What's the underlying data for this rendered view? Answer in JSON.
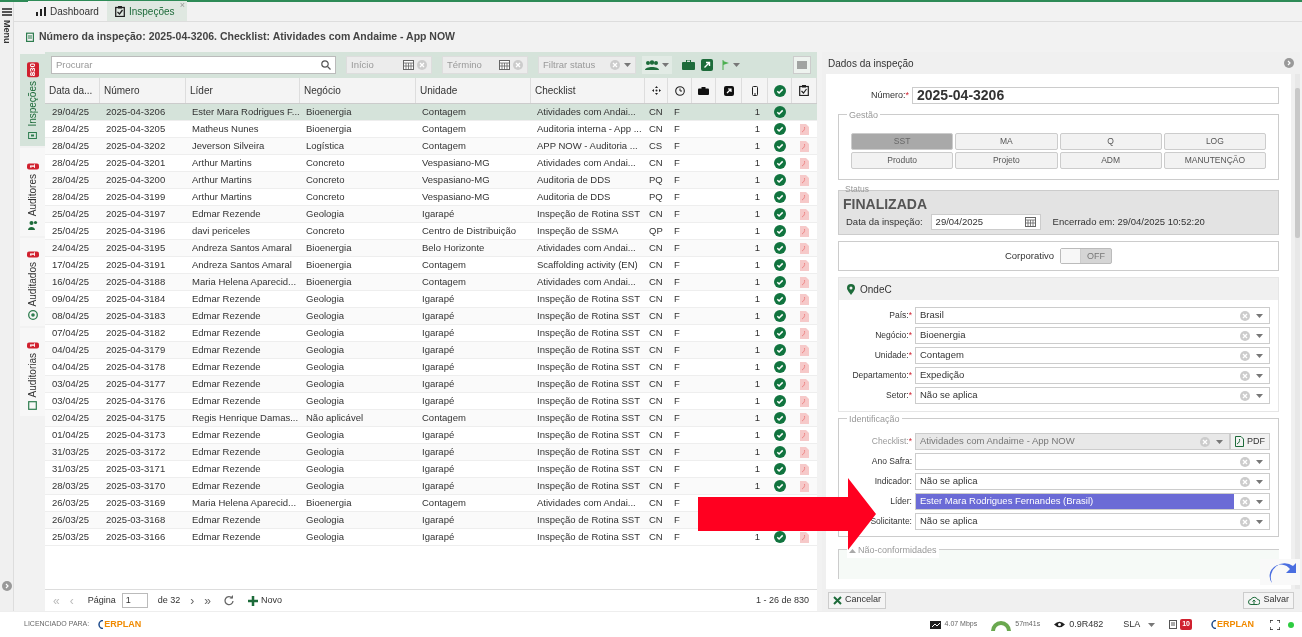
{
  "menu": {
    "label": "Menu"
  },
  "tabs": [
    {
      "label": "Dashboard",
      "selected": false
    },
    {
      "label": "Inspeções",
      "selected": true,
      "close": "×"
    }
  ],
  "title": "Número da inspeção: 2025-04-3206. Checklist: Atividades com Andaime - App NOW",
  "side_tabs": [
    {
      "label": "Inspeções",
      "badge": "830",
      "selected": true
    },
    {
      "label": "Auditores",
      "badge": "1",
      "selected": false
    },
    {
      "label": "Auditados",
      "badge": "1",
      "selected": false
    },
    {
      "label": "Auditorias",
      "badge": "1",
      "selected": false
    }
  ],
  "toolbar": {
    "search": {
      "placeholder": "Procurar"
    },
    "start": {
      "placeholder": "Início"
    },
    "end": {
      "placeholder": "Término"
    },
    "status": {
      "placeholder": "Filtrar status"
    }
  },
  "table": {
    "columns": [
      "Data da...",
      "Número",
      "Líder",
      "Negócio",
      "Unidade",
      "Checklist"
    ],
    "rows": [
      {
        "date": "29/04/25",
        "number": "2025-04-3206",
        "leader": "Ester Mara Rodrigues F...",
        "business": "Bioenergia",
        "unit": "Contagem",
        "checklist": "Atividades com Andai...",
        "code": "CN",
        "status": "F",
        "count": "1",
        "done": true,
        "pdf": false,
        "selected": true
      },
      {
        "date": "28/04/25",
        "number": "2025-04-3205",
        "leader": "Matheus Nunes",
        "business": "Bioenergia",
        "unit": "Contagem",
        "checklist": "Auditoria interna - App ...",
        "code": "CN",
        "status": "F",
        "count": "1",
        "done": true,
        "pdf": true,
        "selected": false
      },
      {
        "date": "28/04/25",
        "number": "2025-04-3202",
        "leader": "Jeverson Silveira",
        "business": "Logística",
        "unit": "Contagem",
        "checklist": "APP NOW - Auditoria ...",
        "code": "CS",
        "status": "F",
        "count": "1",
        "done": true,
        "pdf": true,
        "selected": false
      },
      {
        "date": "28/04/25",
        "number": "2025-04-3201",
        "leader": "Arthur Martins",
        "business": "Concreto",
        "unit": "Vespasiano-MG",
        "checklist": "Atividades com Andai...",
        "code": "CN",
        "status": "F",
        "count": "1",
        "done": true,
        "pdf": true,
        "selected": false
      },
      {
        "date": "28/04/25",
        "number": "2025-04-3200",
        "leader": "Arthur Martins",
        "business": "Concreto",
        "unit": "Vespasiano-MG",
        "checklist": "Auditoria de DDS",
        "code": "PQ",
        "status": "F",
        "count": "1",
        "done": true,
        "pdf": true,
        "selected": false
      },
      {
        "date": "28/04/25",
        "number": "2025-04-3199",
        "leader": "Arthur Martins",
        "business": "Concreto",
        "unit": "Vespasiano-MG",
        "checklist": "Auditoria de DDS",
        "code": "PQ",
        "status": "F",
        "count": "1",
        "done": true,
        "pdf": true,
        "selected": false
      },
      {
        "date": "25/04/25",
        "number": "2025-04-3197",
        "leader": "Edmar Rezende",
        "business": "Geologia",
        "unit": "Igarapé",
        "checklist": "Inspeção de Rotina SST",
        "code": "CN",
        "status": "F",
        "count": "1",
        "done": true,
        "pdf": true,
        "selected": false
      },
      {
        "date": "25/04/25",
        "number": "2025-04-3196",
        "leader": "davi periceles",
        "business": "Concreto",
        "unit": "Centro de Distribuição",
        "checklist": "Inspeção de SSMA",
        "code": "QP",
        "status": "F",
        "count": "1",
        "done": true,
        "pdf": true,
        "selected": false
      },
      {
        "date": "24/04/25",
        "number": "2025-04-3195",
        "leader": "Andreza Santos Amaral",
        "business": "Bioenergia",
        "unit": "Belo Horizonte",
        "checklist": "Atividades com Andai...",
        "code": "CN",
        "status": "F",
        "count": "1",
        "done": true,
        "pdf": true,
        "selected": false
      },
      {
        "date": "17/04/25",
        "number": "2025-04-3191",
        "leader": "Andreza Santos Amaral",
        "business": "Bioenergia",
        "unit": "Contagem",
        "checklist": "Scaffolding activity (EN)",
        "code": "CN",
        "status": "F",
        "count": "1",
        "done": true,
        "pdf": true,
        "selected": false
      },
      {
        "date": "16/04/25",
        "number": "2025-04-3188",
        "leader": "Maria Helena Aparecid...",
        "business": "Bioenergia",
        "unit": "Contagem",
        "checklist": "Atividades com Andai...",
        "code": "CN",
        "status": "F",
        "count": "1",
        "done": true,
        "pdf": true,
        "selected": false
      },
      {
        "date": "09/04/25",
        "number": "2025-04-3184",
        "leader": "Edmar Rezende",
        "business": "Geologia",
        "unit": "Igarapé",
        "checklist": "Inspeção de Rotina SST",
        "code": "CN",
        "status": "F",
        "count": "1",
        "done": true,
        "pdf": true,
        "selected": false
      },
      {
        "date": "08/04/25",
        "number": "2025-04-3183",
        "leader": "Edmar Rezende",
        "business": "Geologia",
        "unit": "Igarapé",
        "checklist": "Inspeção de Rotina SST",
        "code": "CN",
        "status": "F",
        "count": "1",
        "done": true,
        "pdf": true,
        "selected": false
      },
      {
        "date": "07/04/25",
        "number": "2025-04-3182",
        "leader": "Edmar Rezende",
        "business": "Geologia",
        "unit": "Igarapé",
        "checklist": "Inspeção de Rotina SST",
        "code": "CN",
        "status": "F",
        "count": "1",
        "done": true,
        "pdf": true,
        "selected": false
      },
      {
        "date": "04/04/25",
        "number": "2025-04-3179",
        "leader": "Edmar Rezende",
        "business": "Geologia",
        "unit": "Igarapé",
        "checklist": "Inspeção de Rotina SST",
        "code": "CN",
        "status": "F",
        "count": "1",
        "done": true,
        "pdf": true,
        "selected": false
      },
      {
        "date": "04/04/25",
        "number": "2025-04-3178",
        "leader": "Edmar Rezende",
        "business": "Geologia",
        "unit": "Igarapé",
        "checklist": "Inspeção de Rotina SST",
        "code": "CN",
        "status": "F",
        "count": "1",
        "done": true,
        "pdf": true,
        "selected": false
      },
      {
        "date": "03/04/25",
        "number": "2025-04-3177",
        "leader": "Edmar Rezende",
        "business": "Geologia",
        "unit": "Igarapé",
        "checklist": "Inspeção de Rotina SST",
        "code": "CN",
        "status": "F",
        "count": "1",
        "done": true,
        "pdf": true,
        "selected": false
      },
      {
        "date": "03/04/25",
        "number": "2025-04-3176",
        "leader": "Edmar Rezende",
        "business": "Geologia",
        "unit": "Igarapé",
        "checklist": "Inspeção de Rotina SST",
        "code": "CN",
        "status": "F",
        "count": "1",
        "done": true,
        "pdf": true,
        "selected": false
      },
      {
        "date": "02/04/25",
        "number": "2025-04-3175",
        "leader": "Regis Henrique Damas...",
        "business": "Não aplicável",
        "unit": "Contagem",
        "checklist": "Inspeção de Rotina SST",
        "code": "CN",
        "status": "F",
        "count": "1",
        "done": true,
        "pdf": true,
        "selected": false
      },
      {
        "date": "01/04/25",
        "number": "2025-04-3173",
        "leader": "Edmar Rezende",
        "business": "Geologia",
        "unit": "Igarapé",
        "checklist": "Inspeção de Rotina SST",
        "code": "CN",
        "status": "F",
        "count": "1",
        "done": true,
        "pdf": true,
        "selected": false
      },
      {
        "date": "31/03/25",
        "number": "2025-03-3172",
        "leader": "Edmar Rezende",
        "business": "Geologia",
        "unit": "Igarapé",
        "checklist": "Inspeção de Rotina SST",
        "code": "CN",
        "status": "F",
        "count": "1",
        "done": true,
        "pdf": true,
        "selected": false
      },
      {
        "date": "31/03/25",
        "number": "2025-03-3171",
        "leader": "Edmar Rezende",
        "business": "Geologia",
        "unit": "Igarapé",
        "checklist": "Inspeção de Rotina SST",
        "code": "CN",
        "status": "F",
        "count": "1",
        "done": true,
        "pdf": true,
        "selected": false
      },
      {
        "date": "28/03/25",
        "number": "2025-03-3170",
        "leader": "Edmar Rezende",
        "business": "Geologia",
        "unit": "Igarapé",
        "checklist": "Inspeção de Rotina SST",
        "code": "CN",
        "status": "F",
        "count": "1",
        "done": true,
        "pdf": true,
        "selected": false
      },
      {
        "date": "26/03/25",
        "number": "2025-03-3169",
        "leader": "Maria Helena Aparecid...",
        "business": "Bioenergia",
        "unit": "Contagem",
        "checklist": "Atividades com Andai...",
        "code": "CN",
        "status": "F",
        "selected": false
      },
      {
        "date": "26/03/25",
        "number": "2025-03-3168",
        "leader": "Edmar Rezende",
        "business": "Geologia",
        "unit": "Igarapé",
        "checklist": "Inspeção de Rotina SST",
        "code": "CN",
        "status": "F",
        "selected": false
      },
      {
        "date": "25/03/25",
        "number": "2025-03-3166",
        "leader": "Edmar Rezende",
        "business": "Geologia",
        "unit": "Igarapé",
        "checklist": "Inspeção de Rotina SST",
        "code": "CN",
        "status": "F",
        "count": "1",
        "done": true,
        "pdf": true,
        "selected": false
      }
    ]
  },
  "pager": {
    "first": "«",
    "previous": "‹",
    "next": "›",
    "last": "»",
    "page_label": "Página",
    "page": "1",
    "of": "de 32",
    "new": "Novo",
    "range": "1 - 26 de 830"
  },
  "panel": {
    "title": "Dados da inspeção",
    "number": {
      "label": "Número:",
      "required_mark": "*",
      "value": "2025-04-3206"
    },
    "gestao": {
      "legend": "Gestão",
      "buttons": [
        {
          "label": "SST",
          "selected": true
        },
        {
          "label": "MA",
          "selected": false
        },
        {
          "label": "Q",
          "selected": false
        },
        {
          "label": "LOG",
          "selected": false
        },
        {
          "label": "Produto",
          "selected": false
        },
        {
          "label": "Projeto",
          "selected": false
        },
        {
          "label": "ADM",
          "selected": false
        },
        {
          "label": "MANUTENÇÃO",
          "selected": false
        }
      ]
    },
    "status": {
      "legend": "Status",
      "value": "FINALIZADA",
      "date_label": "Data da inspeção:",
      "date": "29/04/2025",
      "closed": "Encerrado em:  29/04/2025 10:52:20"
    },
    "corporativo": {
      "label": "Corporativo",
      "on": false,
      "state_text": "OFF"
    },
    "ondec": {
      "title": "OndeC",
      "fields": [
        {
          "label": "País:",
          "required_mark": "*",
          "value": "Brasil"
        },
        {
          "label": "Negócio:",
          "required_mark": "*",
          "value": "Bioenergia"
        },
        {
          "label": "Unidade:",
          "required_mark": "*",
          "value": "Contagem"
        },
        {
          "label": "Departamento:",
          "required_mark": "*",
          "value": "Expedição"
        },
        {
          "label": "Setor:",
          "required_mark": "*",
          "value": "Não se aplica"
        }
      ]
    },
    "identificacao": {
      "legend": "Identificação",
      "fields": [
        {
          "label": "Checklist:",
          "required_mark": "*",
          "value": "Atividades com Andaime -  App NOW",
          "disabled": true,
          "selected": false,
          "button": "PDF"
        },
        {
          "label": "Ano Safra:",
          "disabled": false,
          "selected": false
        },
        {
          "label": "Indicador:",
          "value": "Não se aplica",
          "disabled": false,
          "selected": false
        },
        {
          "label": "Líder:",
          "value": "Ester Mara Rodrigues Fernandes (Brasil)",
          "disabled": false,
          "selected": true
        },
        {
          "label": "Solicitante:",
          "value": "Não se aplica",
          "disabled": false,
          "selected": false
        }
      ]
    },
    "nao_conformidades": {
      "legend": "Não-conformidades"
    },
    "cancel": "Cancelar",
    "save": "Salvar"
  },
  "status_bar": {
    "licensed": "LICENCIADO PARA:",
    "logo": "ERPLAN",
    "speed": "4.07 Mbps",
    "time": "57m41s",
    "version": "0.9R482",
    "sla": "SLA",
    "alerts": "10",
    "logo_right": "ERPLAN"
  }
}
